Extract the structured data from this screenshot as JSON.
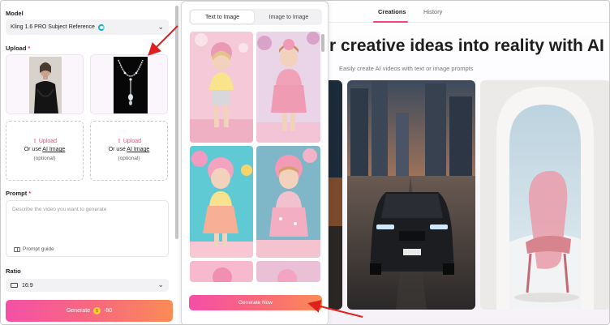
{
  "left_panel": {
    "model_label": "Model",
    "model_value": "Kling 1.6 PRO Subject Reference",
    "upload_label": "Upload",
    "upload_required": "*",
    "upload_slots": [
      {
        "action": "Upload",
        "alt_prefix": "Or use ",
        "alt_link": "AI Image",
        "note": "(optional)"
      },
      {
        "action": "Upload",
        "alt_prefix": "Or use ",
        "alt_link": "AI Image",
        "note": "(optional)"
      }
    ],
    "prompt_label": "Prompt",
    "prompt_required": "*",
    "prompt_placeholder": "Describe the video you want to generate",
    "prompt_guide": "Prompt guide",
    "ratio_label": "Ratio",
    "ratio_value": "16:9",
    "generate_label": "Generate",
    "generate_cost": "-80"
  },
  "middle_panel": {
    "tabs": [
      "Text to Image",
      "Image to Image"
    ],
    "active_tab": "Text to Image",
    "generate_button": "Generate Now"
  },
  "right_panel": {
    "nav_tabs": [
      "Creations",
      "History"
    ],
    "active_nav": "Creations",
    "headline": "r creative ideas into reality with AI",
    "subline": "Easily create AI videos with text or image prompts"
  },
  "colors": {
    "accent_pink": "#f0457a",
    "gradient_start": "#f450a6",
    "gradient_end": "#fb8c55",
    "annotation_red": "#e0201e"
  },
  "icons": [
    "chevron-down-icon",
    "loading-spinner-icon",
    "upload-icon",
    "book-icon",
    "aspect-ratio-icon",
    "coin-icon"
  ]
}
